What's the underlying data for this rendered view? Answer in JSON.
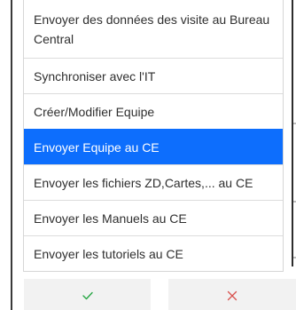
{
  "menu": {
    "items": [
      {
        "label": "Envoyer des données des visite au Bureau Central"
      },
      {
        "label": "Synchroniser avec l'IT"
      },
      {
        "label": "Créer/Modifier Equipe"
      },
      {
        "label": "Envoyer Equipe au CE"
      },
      {
        "label": "Envoyer les fichiers ZD,Cartes,... au CE"
      },
      {
        "label": "Envoyer les Manuels au CE"
      },
      {
        "label": "Envoyer les tutoriels au CE"
      }
    ],
    "selected_index": 3
  },
  "actions": {
    "confirm_icon": "check-icon",
    "cancel_icon": "close-icon"
  },
  "colors": {
    "selected_bg": "#0d6efd",
    "confirm": "#28a745",
    "cancel": "#d9534f"
  }
}
